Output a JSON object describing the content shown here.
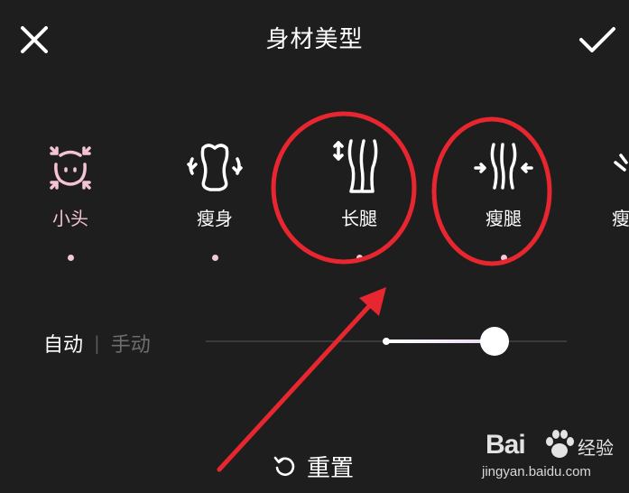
{
  "header": {
    "title": "身材美型",
    "close_icon": "close-icon",
    "confirm_icon": "check-icon"
  },
  "tools": [
    {
      "id": "small-head",
      "label": "小头",
      "icon": "small-head-icon",
      "active": true,
      "dot": true
    },
    {
      "id": "slim-body",
      "label": "瘦身",
      "icon": "slim-body-icon",
      "active": false,
      "dot": true
    },
    {
      "id": "long-legs",
      "label": "长腿",
      "icon": "long-legs-icon",
      "active": false,
      "dot": true
    },
    {
      "id": "slim-legs",
      "label": "瘦腿",
      "icon": "slim-legs-icon",
      "active": false,
      "dot": true
    },
    {
      "id": "partial",
      "label": "瘦",
      "icon": "partial-tool-icon",
      "active": false,
      "dot": false
    }
  ],
  "mode": {
    "auto_label": "自动",
    "separator": "|",
    "manual_label": "手动",
    "selected": "自动"
  },
  "slider": {
    "start_fraction": 0.5,
    "value_fraction": 0.8
  },
  "reset": {
    "label": "重置",
    "icon": "reset-icon"
  },
  "watermark": {
    "brand": "Bai",
    "brand_suffix": "经验",
    "url": "jingyan.baidu.com"
  },
  "colors": {
    "background": "#1e1e1f",
    "active_pink": "#f5c3d6",
    "annotation_red": "#e8262f",
    "muted_text": "#6e6e70"
  }
}
